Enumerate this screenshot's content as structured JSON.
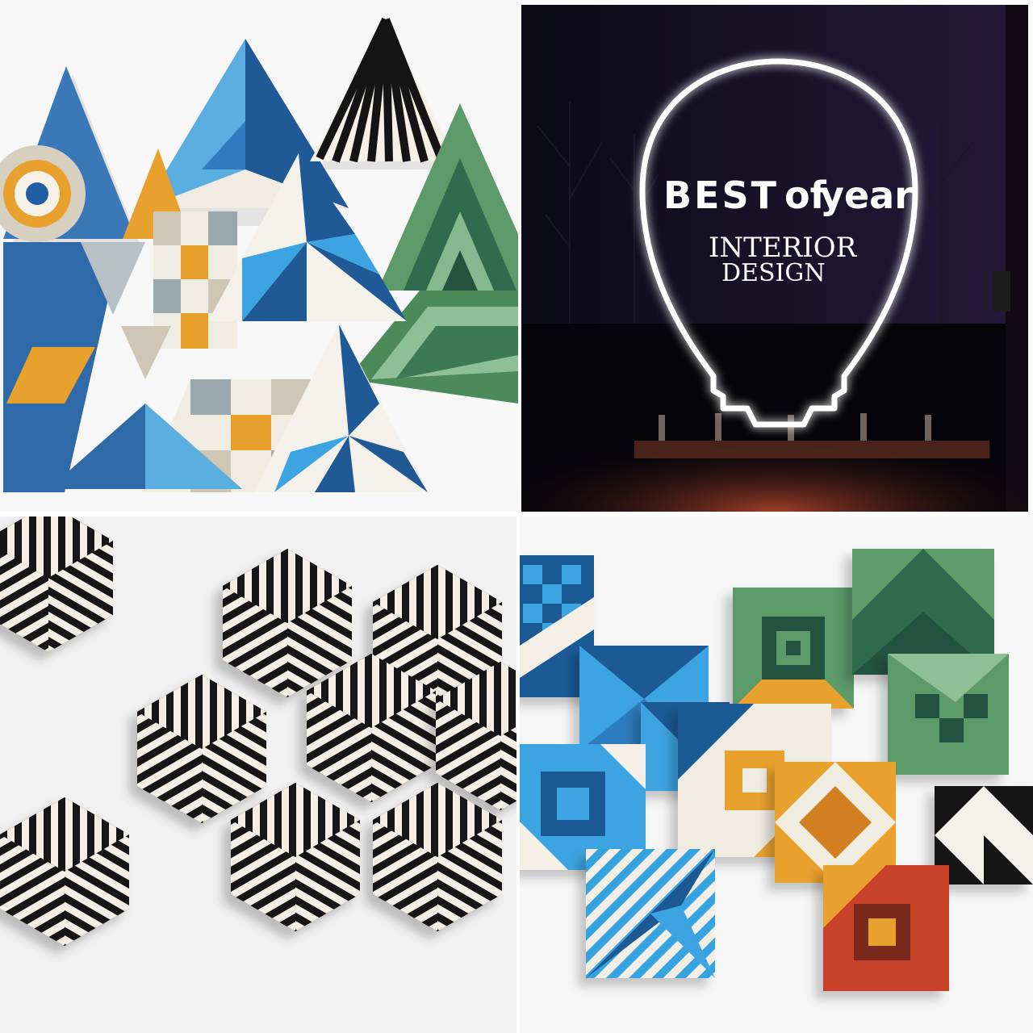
{
  "panels": {
    "triangles": {
      "label": ""
    },
    "award": {
      "headline_a": "BEST",
      "headline_b": "of",
      "headline_c": "year",
      "magazine_line1": "INTERIOR",
      "magazine_line2": "DESIGN"
    },
    "hexagons": {
      "label": ""
    },
    "squares": {
      "label": ""
    }
  },
  "colors": {
    "blue": "#2e6da8",
    "light_blue": "#35a3e0",
    "navy": "#163a6b",
    "orange": "#e9a12e",
    "green": "#4b8a5e",
    "dark_green": "#24523f",
    "cream": "#f1ece2",
    "beige": "#cfc6b6",
    "black": "#141414",
    "glow": "#ffffff"
  }
}
